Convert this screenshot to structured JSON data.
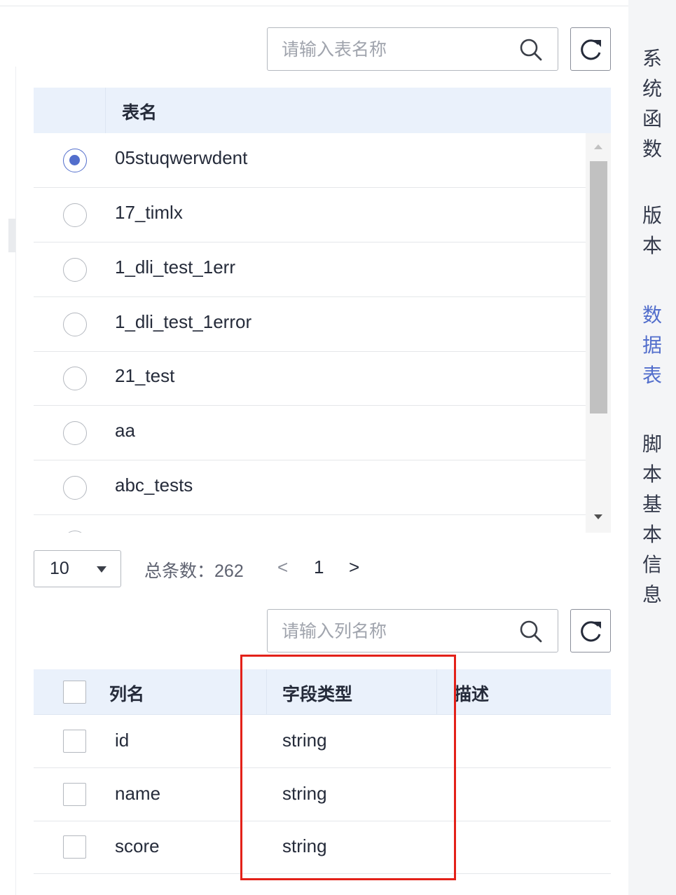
{
  "table_search": {
    "placeholder": "请输入表名称"
  },
  "table_list": {
    "header": "表名",
    "rows": [
      {
        "name": "05stuqwerwdent",
        "selected": true
      },
      {
        "name": "17_timlx",
        "selected": false
      },
      {
        "name": "1_dli_test_1err",
        "selected": false
      },
      {
        "name": "1_dli_test_1error",
        "selected": false
      },
      {
        "name": "21_test",
        "selected": false
      },
      {
        "name": "aa",
        "selected": false
      },
      {
        "name": "abc_tests",
        "selected": false
      }
    ]
  },
  "pagination": {
    "page_size": "10",
    "total_label": "总条数：",
    "total_count": "262",
    "prev": "<",
    "current_page": "1",
    "next": ">"
  },
  "column_search": {
    "placeholder": "请输入列名称"
  },
  "column_table": {
    "headers": [
      "列名",
      "字段类型",
      "描述"
    ],
    "rows": [
      {
        "name": "id",
        "type": "string",
        "desc": ""
      },
      {
        "name": "name",
        "type": "string",
        "desc": ""
      },
      {
        "name": "score",
        "type": "string",
        "desc": ""
      }
    ]
  },
  "side_panel": {
    "items": [
      {
        "label": [
          "系",
          "统",
          "函",
          "数"
        ],
        "active": false
      },
      {
        "label": [
          "版",
          "本"
        ],
        "active": false
      },
      {
        "label": [
          "数",
          "据",
          "表"
        ],
        "active": true
      },
      {
        "label": [
          "脚",
          "本",
          "基",
          "本",
          "信",
          "息"
        ],
        "active": false
      }
    ]
  },
  "colors": {
    "accent": "#526ecc",
    "header_bg": "#eaf1fb",
    "highlight_box": "#e32119"
  },
  "icons": {
    "search": "search-icon",
    "refresh": "refresh-icon",
    "dropdown": "caret-down-icon"
  }
}
